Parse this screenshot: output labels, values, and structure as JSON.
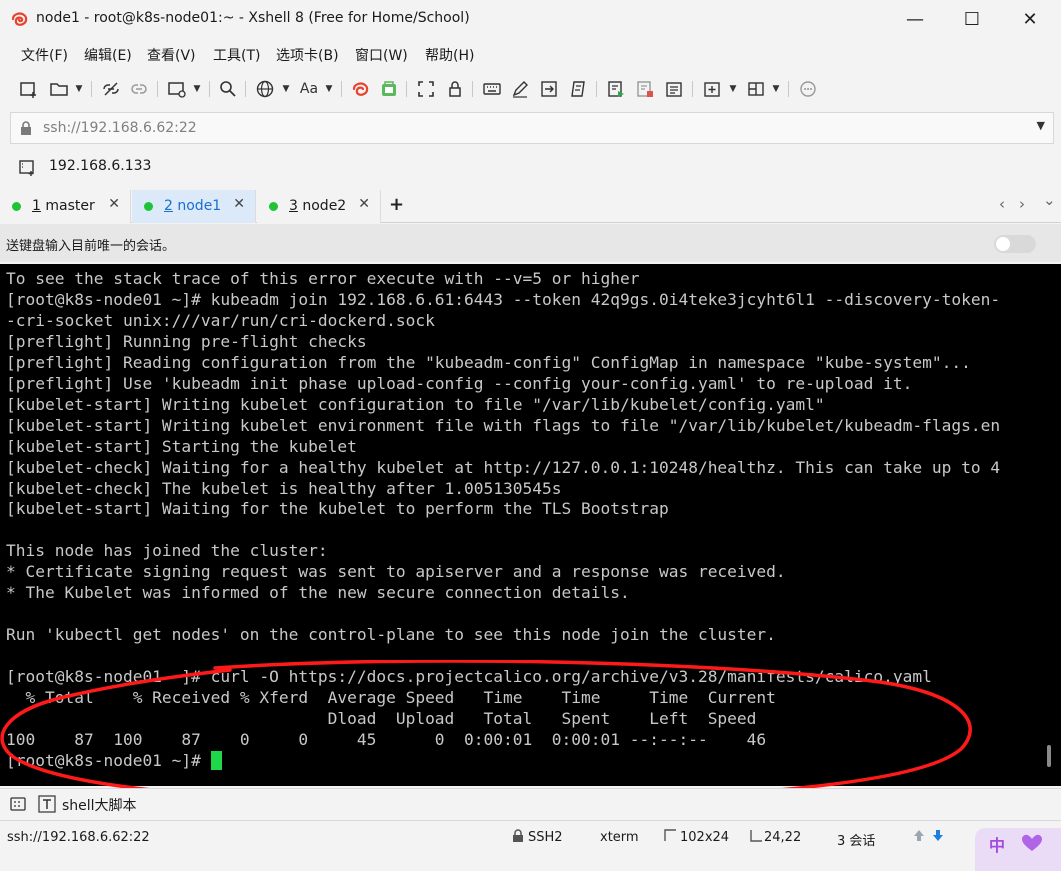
{
  "window": {
    "title": "node1 - root@k8s-node01:~ - Xshell 8 (Free for Home/School)",
    "minimize": "—",
    "maximize": "☐",
    "close": "✕"
  },
  "menu": {
    "items": [
      "文件(F)",
      "编辑(E)",
      "查看(V)",
      "工具(T)",
      "选项卡(B)",
      "窗口(W)",
      "帮助(H)"
    ]
  },
  "toolbar": {
    "font_label": "Aa"
  },
  "address": {
    "value": "ssh://192.168.6.62:22"
  },
  "linkbar": {
    "label": "192.168.6.133"
  },
  "tabs": [
    {
      "num": "1",
      "name": " master",
      "active": false,
      "status_color": "#1fc336"
    },
    {
      "num": "2",
      "name": " node1",
      "active": true,
      "status_color": "#1fc336"
    },
    {
      "num": "3",
      "name": " node2",
      "active": false,
      "status_color": "#1fc336"
    }
  ],
  "tab_controls": {
    "add": "+",
    "prev": "‹",
    "next": "›",
    "menu": "⌄"
  },
  "infobar": {
    "text": "送键盘输入目前唯一的会话。"
  },
  "terminal": {
    "lines": [
      "To see the stack trace of this error execute with --v=5 or higher",
      "[root@k8s-node01 ~]# kubeadm join 192.168.6.61:6443 --token 42q9gs.0i4teke3jcyht6l1 --discovery-token-",
      "-cri-socket unix:///var/run/cri-dockerd.sock",
      "[preflight] Running pre-flight checks",
      "[preflight] Reading configuration from the \"kubeadm-config\" ConfigMap in namespace \"kube-system\"...",
      "[preflight] Use 'kubeadm init phase upload-config --config your-config.yaml' to re-upload it.",
      "[kubelet-start] Writing kubelet configuration to file \"/var/lib/kubelet/config.yaml\"",
      "[kubelet-start] Writing kubelet environment file with flags to file \"/var/lib/kubelet/kubeadm-flags.en",
      "[kubelet-start] Starting the kubelet",
      "[kubelet-check] Waiting for a healthy kubelet at http://127.0.0.1:10248/healthz. This can take up to 4",
      "[kubelet-check] The kubelet is healthy after 1.005130545s",
      "[kubelet-start] Waiting for the kubelet to perform the TLS Bootstrap",
      "",
      "This node has joined the cluster:",
      "* Certificate signing request was sent to apiserver and a response was received.",
      "* The Kubelet was informed of the new secure connection details.",
      "",
      "Run 'kubectl get nodes' on the control-plane to see this node join the cluster.",
      "",
      "[root@k8s-node01 ~]# curl -O https://docs.projectcalico.org/archive/v3.28/manifests/calico.yaml",
      "  % Total    % Received % Xferd  Average Speed   Time    Time     Time  Current",
      "                                 Dload  Upload   Total   Spent    Left  Speed",
      "100    87  100    87    0     0     45      0  0:00:01  0:00:01 --:--:--    46",
      "[root@k8s-node01 ~]# "
    ],
    "fg_color": "#c8c8c8",
    "bg_color": "#000000",
    "cursor_color": "#1fd84a",
    "annotation_color": "#ff1a1a"
  },
  "bottom_toolbar": {
    "label": "shell大脚本"
  },
  "status": {
    "address": "ssh://192.168.6.62:22",
    "protocol": "SSH2",
    "term": "xterm",
    "size": "102x24",
    "cursor": "24,22",
    "sessions": "3 会话",
    "ime": "中"
  }
}
